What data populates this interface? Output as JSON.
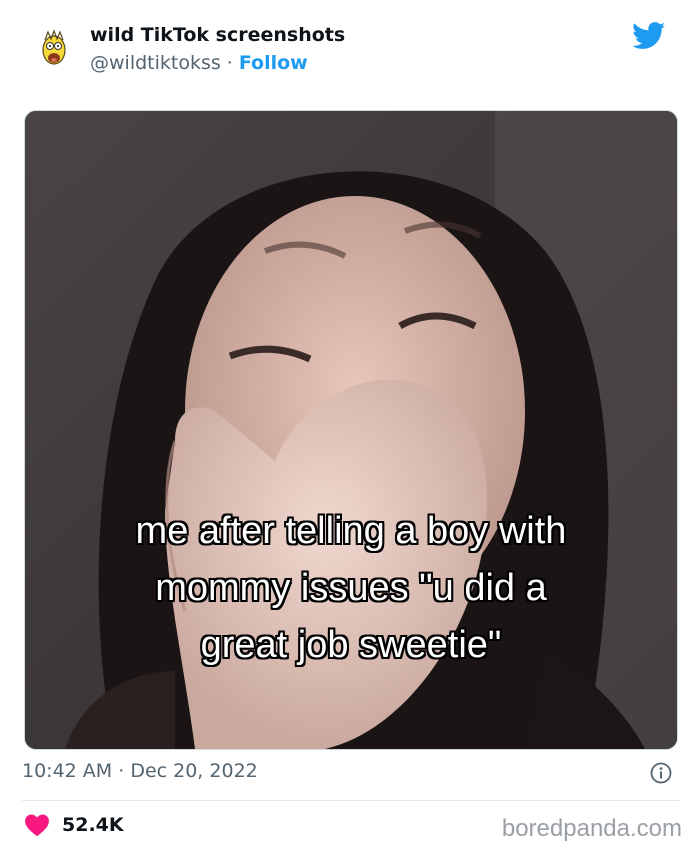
{
  "tweet": {
    "display_name": "wild TikTok screenshots",
    "handle": "@wildtiktokss",
    "separator": "·",
    "follow_label": "Follow",
    "time": "10:42 AM",
    "date_separator": "·",
    "date": "Dec 20, 2022",
    "like_count": "52.4K"
  },
  "media": {
    "caption_lines": [
      "me after telling a boy with",
      "mommy issues \"u did a",
      "great job sweetie\""
    ]
  },
  "watermark": "boredpanda.com",
  "colors": {
    "accent": "#1d9bf0",
    "heart": "#f91880",
    "muted": "#536471"
  },
  "icons": {
    "platform": "twitter-bird-icon",
    "info": "info-icon",
    "like": "heart-icon"
  }
}
